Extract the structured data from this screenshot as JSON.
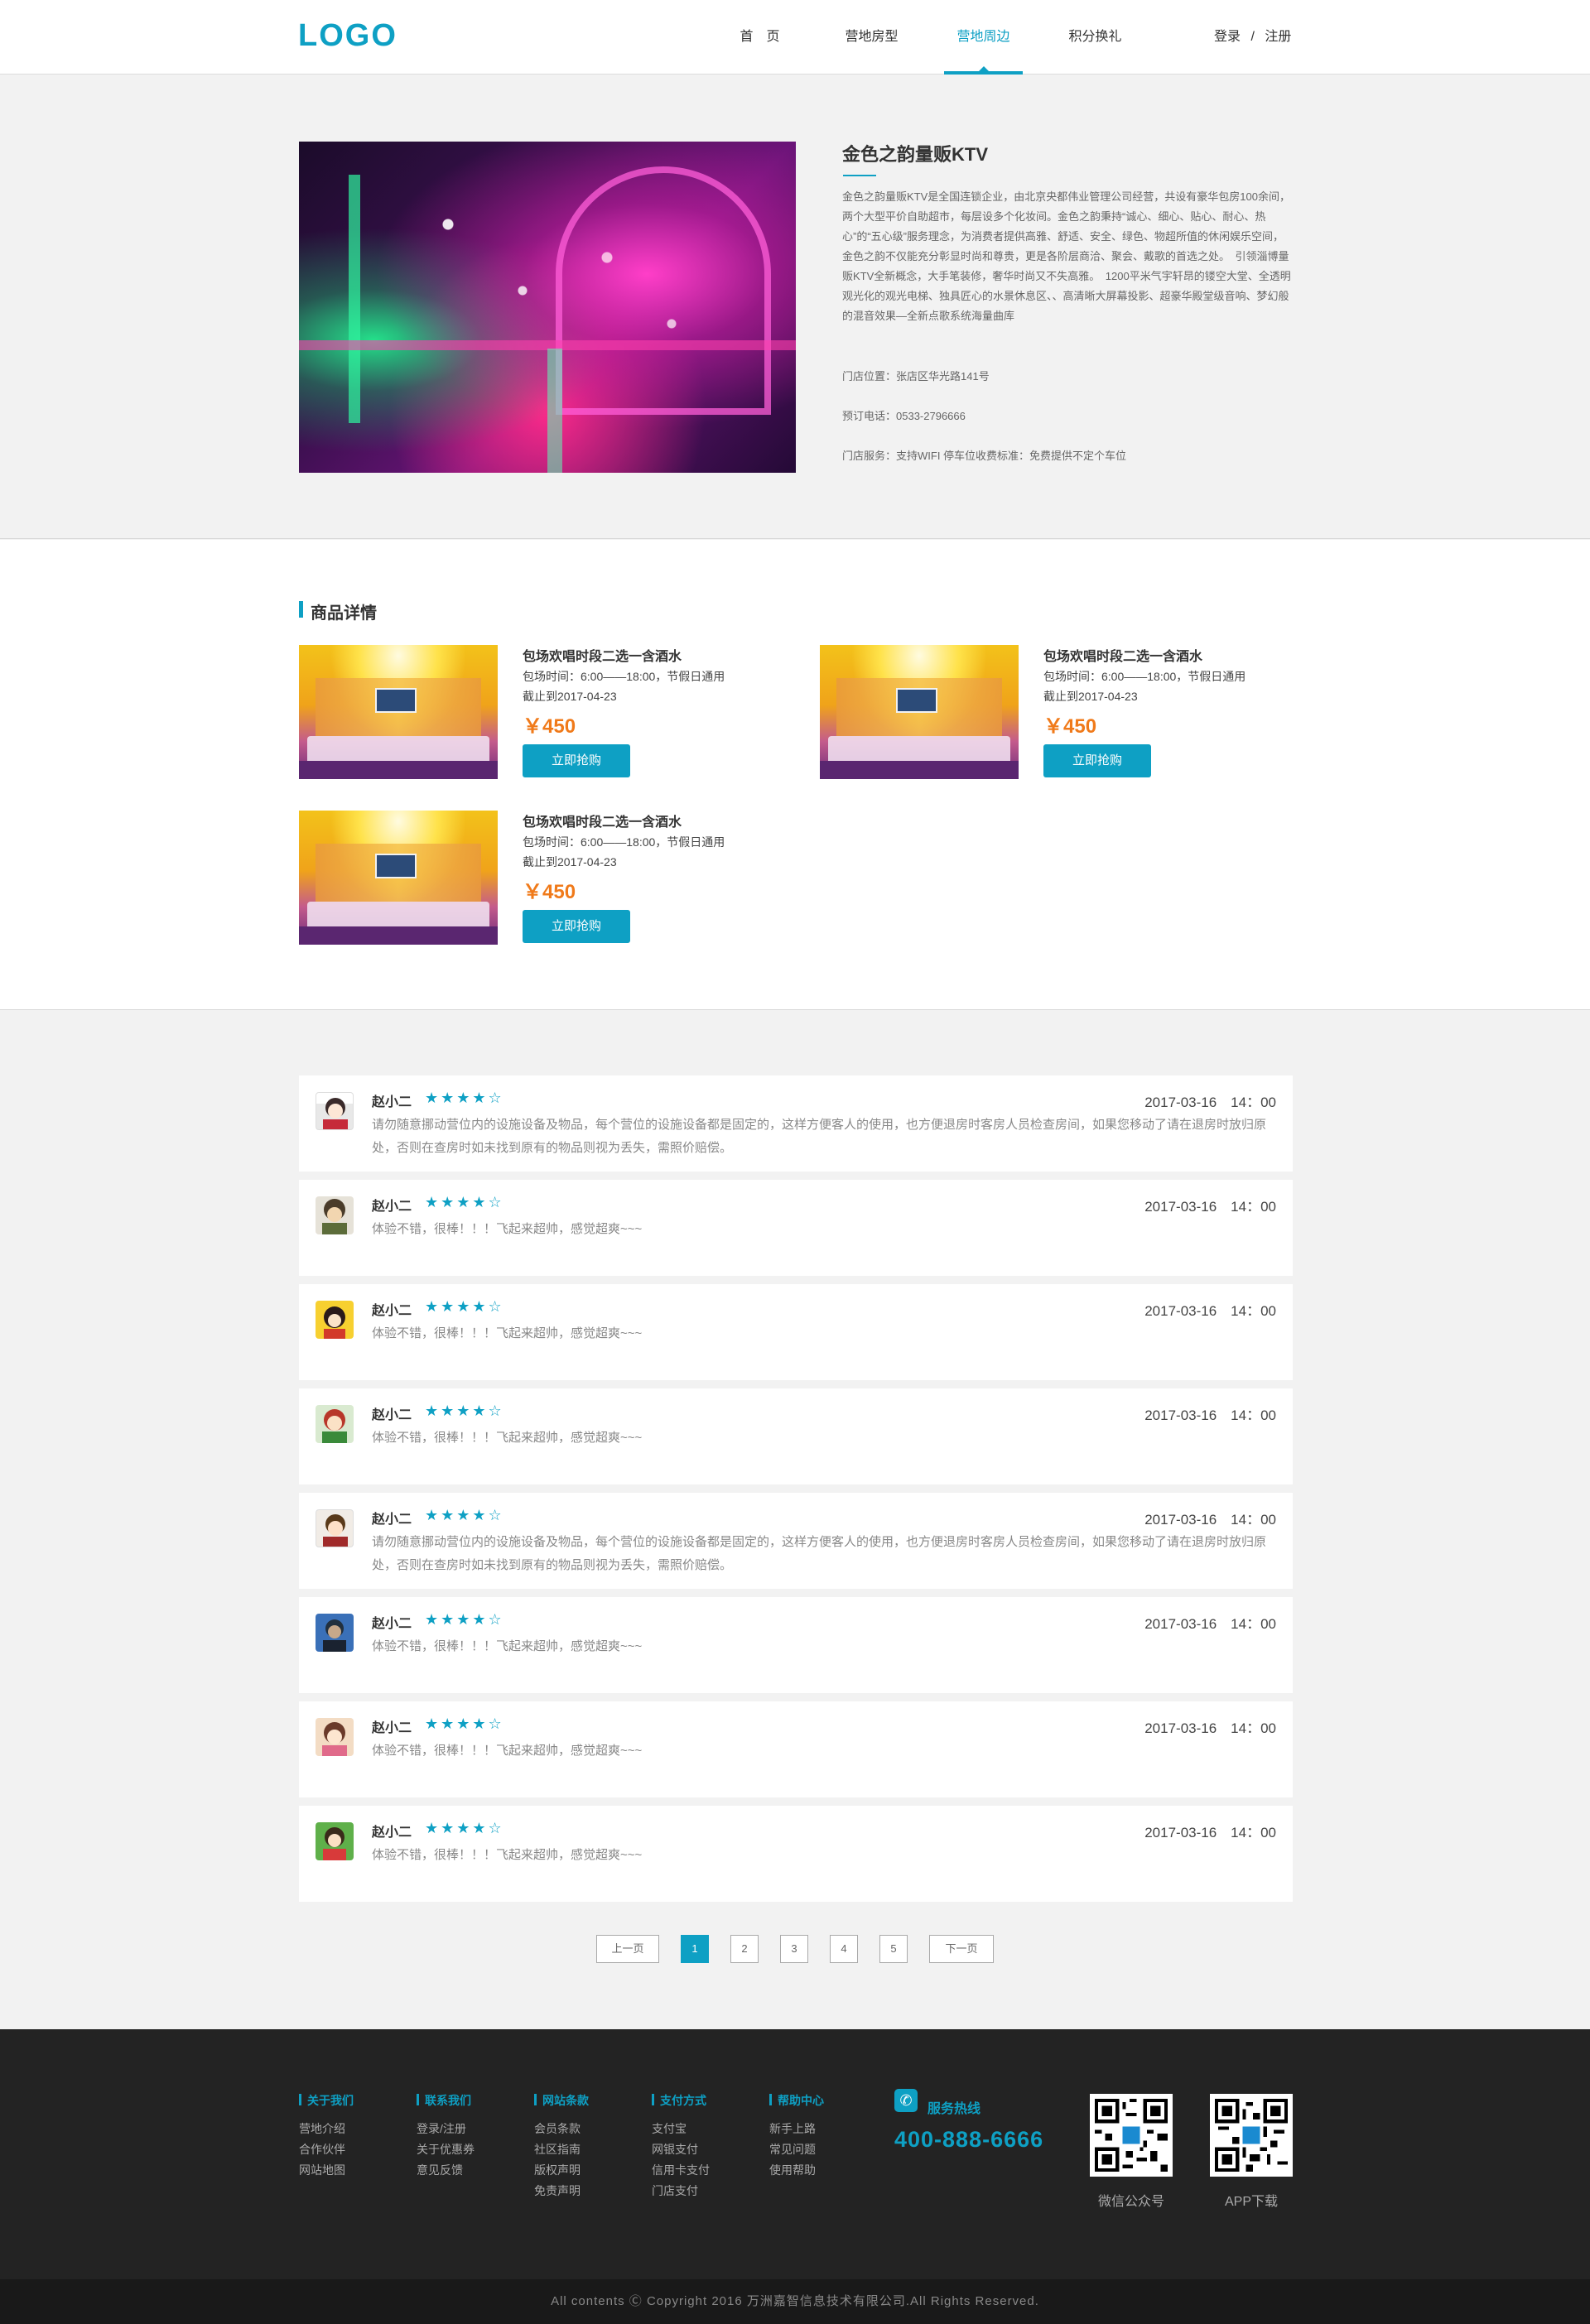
{
  "header": {
    "logo": "LOGO",
    "nav": [
      "首　页",
      "营地房型",
      "营地周边",
      "积分换礼"
    ],
    "active_index": 2,
    "login": "登录",
    "separator": "/",
    "register": "注册"
  },
  "store": {
    "name": "金色之韵量贩KTV",
    "description": "金色之韵量贩KTV是全国连锁企业，由北京央都伟业管理公司经营，共设有豪华包房100余间，两个大型平价自助超市，每层设多个化妆间。金色之韵秉持“诚心、细心、贴心、耐心、热心”的“五心级”服务理念，为消费者提供高雅、舒适、安全、绿色、物超所值的休闲娱乐空间，金色之韵不仅能充分彰显时尚和尊贵，更是各阶层商洽、聚会、戴歌的首选之处。　引领淄博量贩KTV全新概念，大手笔装修，奢华时尚又不失高雅。　1200平米气宇轩昂的镂空大堂、全透明观光化的观光电梯、独具匠心的水景休息区、、高清晰大屏幕投影、超豪华殿堂级音响、梦幻般的混音效果—全新点歌系统海量曲库",
    "address": "门店位置：张店区华光路141号",
    "phone": "预订电话：0533-2796666",
    "services": "门店服务：支持WIFI 停车位收费标准：免费提供不定个车位"
  },
  "products": {
    "section_title": "商品详情",
    "items": [
      {
        "name": "包场欢唱时段二选一含酒水",
        "time": "包场时间：6:00——18:00，节假日通用",
        "deadline": "截止到2017-04-23",
        "price": "￥450",
        "button": "立即抢购"
      },
      {
        "name": "包场欢唱时段二选一含酒水",
        "time": "包场时间：6:00——18:00，节假日通用",
        "deadline": "截止到2017-04-23",
        "price": "￥450",
        "button": "立即抢购"
      },
      {
        "name": "包场欢唱时段二选一含酒水",
        "time": "包场时间：6:00——18:00，节假日通用",
        "deadline": "截止到2017-04-23",
        "price": "￥450",
        "button": "立即抢购"
      }
    ]
  },
  "reviews": [
    {
      "name": "赵小二",
      "rating": 4,
      "stars": "★★★★☆",
      "date": "2017-03-16　14：00",
      "text": "请勿随意挪动营位内的设施设备及物品，每个营位的设施设备都是固定的，这样方便客人的使用，也方便退房时客房人员检查房间，如果您移动了请在退房时放归原处，否则在查房时如未找到原有的物品则视为丢失，需照价赔偿。"
    },
    {
      "name": "赵小二",
      "rating": 4,
      "stars": "★★★★☆",
      "date": "2017-03-16　14：00",
      "text": "体验不错，很棒！！！飞起来超帅，感觉超爽~~~"
    },
    {
      "name": "赵小二",
      "rating": 4,
      "stars": "★★★★☆",
      "date": "2017-03-16　14：00",
      "text": "体验不错，很棒！！！飞起来超帅，感觉超爽~~~"
    },
    {
      "name": "赵小二",
      "rating": 4,
      "stars": "★★★★☆",
      "date": "2017-03-16　14：00",
      "text": "体验不错，很棒！！！飞起来超帅，感觉超爽~~~"
    },
    {
      "name": "赵小二",
      "rating": 4,
      "stars": "★★★★☆",
      "date": "2017-03-16　14：00",
      "text": "请勿随意挪动营位内的设施设备及物品，每个营位的设施设备都是固定的，这样方便客人的使用，也方便退房时客房人员检查房间，如果您移动了请在退房时放归原处，否则在查房时如未找到原有的物品则视为丢失，需照价赔偿。"
    },
    {
      "name": "赵小二",
      "rating": 4,
      "stars": "★★★★☆",
      "date": "2017-03-16　14：00",
      "text": "体验不错，很棒！！！飞起来超帅，感觉超爽~~~"
    },
    {
      "name": "赵小二",
      "rating": 4,
      "stars": "★★★★☆",
      "date": "2017-03-16　14：00",
      "text": "体验不错，很棒！！！飞起来超帅，感觉超爽~~~"
    },
    {
      "name": "赵小二",
      "rating": 4,
      "stars": "★★★★☆",
      "date": "2017-03-16　14：00",
      "text": "体验不错，很棒！！！飞起来超帅，感觉超爽~~~"
    }
  ],
  "pagination": {
    "prev": "上一页",
    "pages": [
      "1",
      "2",
      "3",
      "4",
      "5"
    ],
    "current": "1",
    "next": "下一页"
  },
  "footer": {
    "columns": [
      {
        "title": "关于我们",
        "links": [
          "营地介绍",
          "合作伙伴",
          "网站地图"
        ]
      },
      {
        "title": "联系我们",
        "links": [
          "登录/注册",
          "关于优惠券",
          "意见反馈"
        ]
      },
      {
        "title": "网站条款",
        "links": [
          "会员条款",
          "社区指南",
          "版权声明",
          "免责声明"
        ]
      },
      {
        "title": "支付方式",
        "links": [
          "支付宝",
          "网银支付",
          "信用卡支付",
          "门店支付"
        ]
      },
      {
        "title": "帮助中心",
        "links": [
          "新手上路",
          "常见问题",
          "使用帮助"
        ]
      }
    ],
    "hotline_label": "服务热线",
    "hotline_number": "400-888-6666",
    "qr_codes": [
      "微信公众号",
      "APP下载"
    ],
    "copyright": "All contents Ⓒ Copyright 2016 万洲嘉智信息技术有限公司.All Rights Reserved."
  },
  "colors": {
    "accent": "#0ea0c4",
    "price": "#f07a1a",
    "footer_bg": "#232323"
  },
  "icons": [
    "phone-icon",
    "qr-code-icon",
    "avatar-icon",
    "star-icon"
  ]
}
